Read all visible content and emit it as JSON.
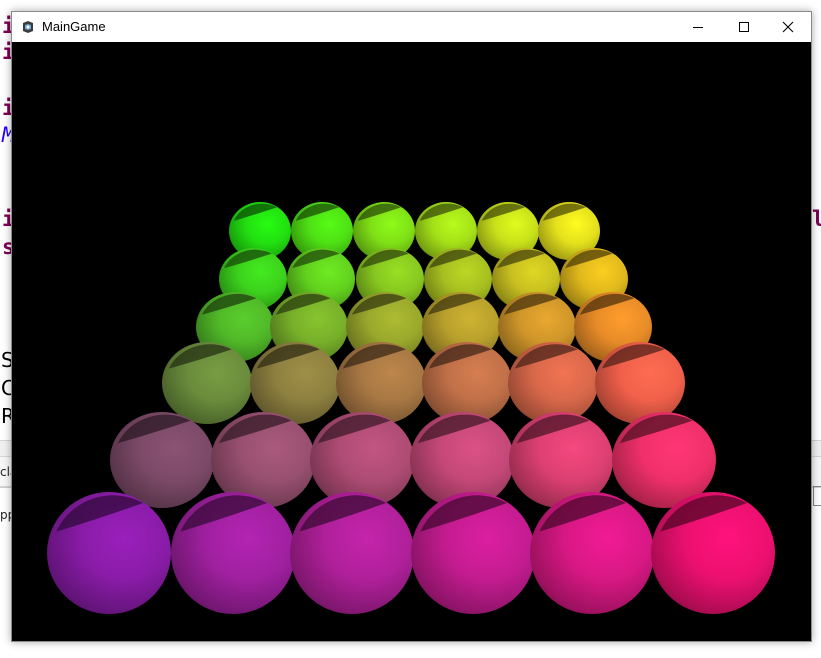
{
  "window": {
    "title": "MainGame",
    "icon": "app-icon",
    "controls": [
      "minimize-icon",
      "maximize-icon",
      "close-icon"
    ]
  },
  "background": {
    "code_fragments": [
      "i",
      "i",
      "i",
      "M",
      "i",
      "s",
      "l",
      "S",
      "C",
      "R",
      "cla",
      "pp"
    ]
  },
  "scene": {
    "background_color": "#000000",
    "rows": [
      {
        "colors": [
          "#22e010",
          "#4ee014",
          "#7fe016",
          "#a4e018",
          "#c8e01a",
          "#e4e01c"
        ]
      },
      {
        "colors": [
          "#3cd21c",
          "#62d21e",
          "#88c820",
          "#a8c020",
          "#c8c020",
          "#e0b81c"
        ]
      },
      {
        "colors": [
          "#50b828",
          "#78b02a",
          "#9aa82c",
          "#b8a02c",
          "#d0962a",
          "#e88c28"
        ]
      },
      {
        "colors": [
          "#6a8c3c",
          "#8e8040",
          "#a87844",
          "#c07048",
          "#d8684a",
          "#f0604a"
        ]
      },
      {
        "colors": [
          "#7c4a68",
          "#985070",
          "#ae4c74",
          "#c44878",
          "#dc4072",
          "#f0306a"
        ]
      },
      {
        "colors": [
          "#8a1ca8",
          "#a020a0",
          "#b0209a",
          "#c41c90",
          "#d81884",
          "#ec1070"
        ]
      }
    ]
  }
}
